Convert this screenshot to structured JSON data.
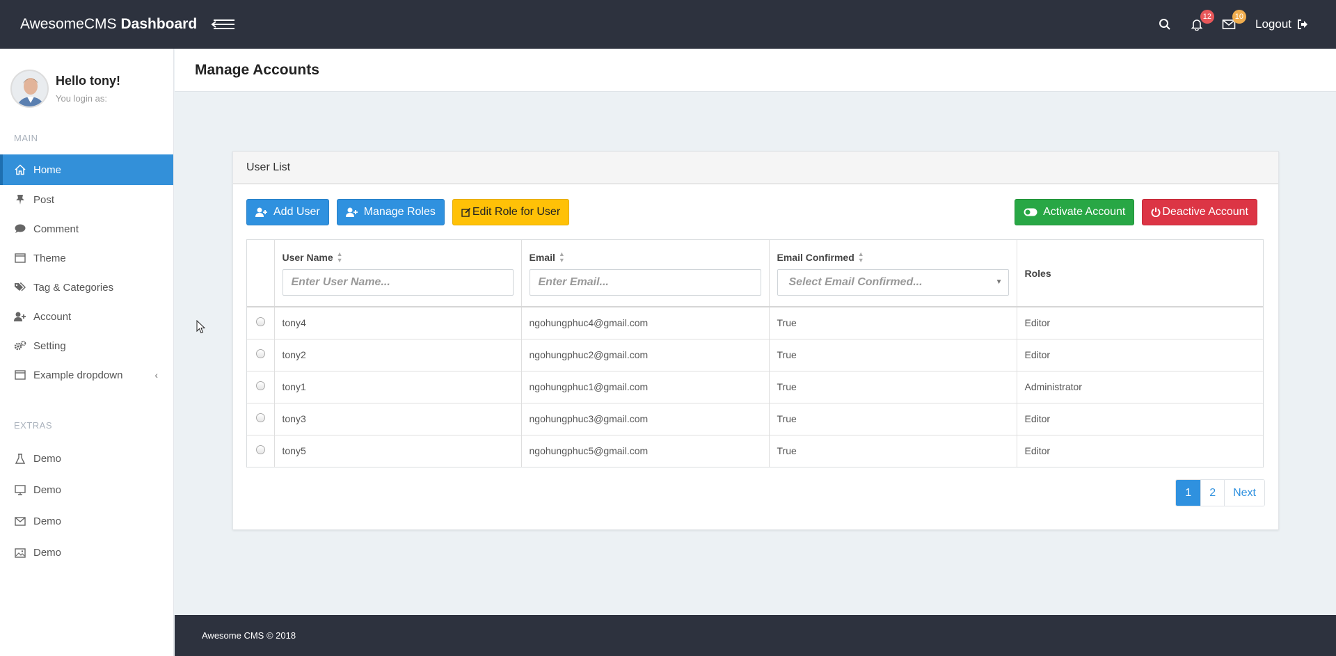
{
  "app": {
    "brand_light": "AwesomeCMS",
    "brand_bold": "Dashboard"
  },
  "topbar": {
    "notifications_count": "12",
    "messages_count": "10",
    "logout_label": "Logout",
    "colors": {
      "bar": "#2d323e",
      "notif_badge": "#e8575a",
      "msg_badge": "#f0ad4e"
    }
  },
  "sidebar": {
    "hello": "Hello tony!",
    "login_as": "You login as:",
    "main_label": "MAIN",
    "extras_label": "EXTRAS",
    "items": [
      {
        "label": "Home",
        "icon": "home-icon"
      },
      {
        "label": "Post",
        "icon": "pin-icon"
      },
      {
        "label": "Comment",
        "icon": "comment-icon"
      },
      {
        "label": "Theme",
        "icon": "window-icon"
      },
      {
        "label": "Tag & Categories",
        "icon": "tags-icon"
      },
      {
        "label": "Account",
        "icon": "user-plus-icon"
      },
      {
        "label": "Setting",
        "icon": "gears-icon"
      },
      {
        "label": "Example dropdown",
        "icon": "window-icon",
        "chevron": "‹"
      }
    ],
    "extras": [
      {
        "label": "Demo",
        "icon": "flask-icon"
      },
      {
        "label": "Demo",
        "icon": "desktop-icon"
      },
      {
        "label": "Demo",
        "icon": "envelope-icon"
      },
      {
        "label": "Demo",
        "icon": "image-icon"
      }
    ]
  },
  "page": {
    "title": "Manage Accounts"
  },
  "panel": {
    "title": "User List",
    "buttons": {
      "add_user": "Add User",
      "manage_roles": "Manage Roles",
      "edit_role": "Edit Role for User",
      "activate": "Activate Account",
      "deactivate": "Deactive Account"
    },
    "table": {
      "columns": {
        "username": "User Name",
        "email": "Email",
        "email_confirmed": "Email Confirmed",
        "roles": "Roles"
      },
      "filters": {
        "username_placeholder": "Enter User Name...",
        "email_placeholder": "Enter Email...",
        "confirmed_placeholder": "Select Email Confirmed..."
      },
      "rows": [
        {
          "username": "tony4",
          "email": "ngohungphuc4@gmail.com",
          "confirmed": "True",
          "role": "Editor"
        },
        {
          "username": "tony2",
          "email": "ngohungphuc2@gmail.com",
          "confirmed": "True",
          "role": "Editor"
        },
        {
          "username": "tony1",
          "email": "ngohungphuc1@gmail.com",
          "confirmed": "True",
          "role": "Administrator"
        },
        {
          "username": "tony3",
          "email": "ngohungphuc3@gmail.com",
          "confirmed": "True",
          "role": "Editor"
        },
        {
          "username": "tony5",
          "email": "ngohungphuc5@gmail.com",
          "confirmed": "True",
          "role": "Editor"
        }
      ]
    },
    "pagination": {
      "page1": "1",
      "page2": "2",
      "next": "Next"
    }
  },
  "footer": {
    "text": "Awesome CMS © 2018"
  }
}
